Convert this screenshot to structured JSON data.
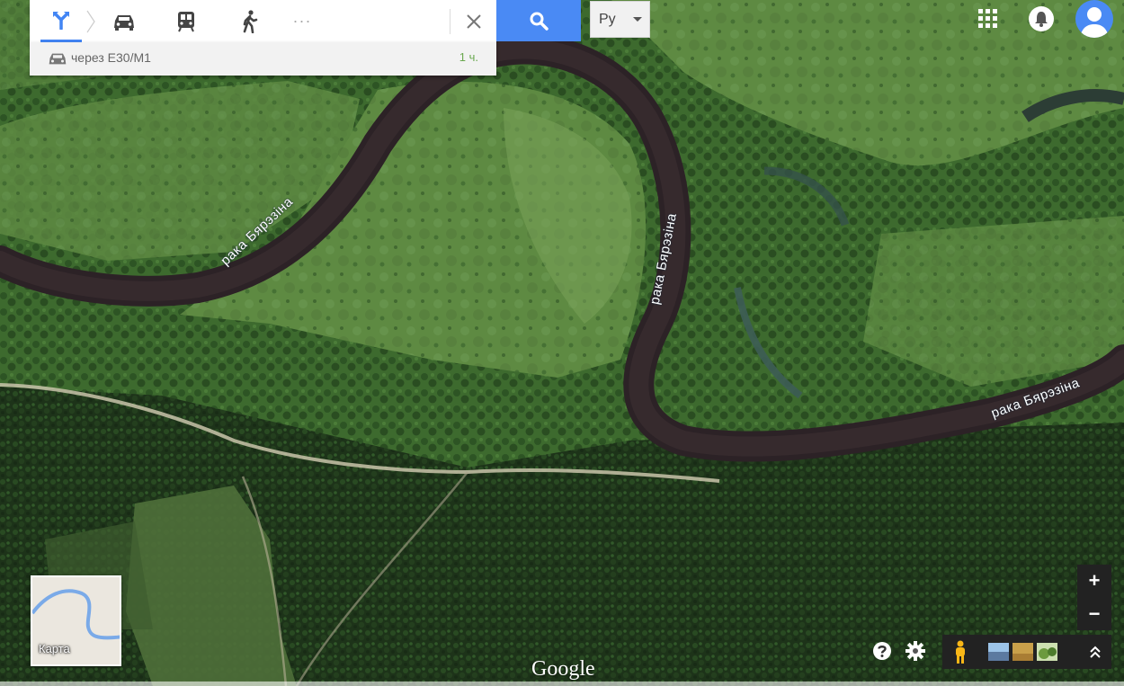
{
  "directions": {
    "modes": [
      {
        "name": "directions-mode-icon",
        "active": true
      },
      {
        "name": "car-icon"
      },
      {
        "name": "transit-icon"
      },
      {
        "name": "walk-icon"
      },
      {
        "name": "more-options-icon"
      }
    ],
    "more_label": "···",
    "route_via": "через E30/M1",
    "route_time": "1 ч."
  },
  "lang": {
    "label": "Ру"
  },
  "map": {
    "river_labels": [
      "рака Бярэзіна",
      "рака Бярэзіна",
      "рака Бярэзіна"
    ]
  },
  "minimap": {
    "label": "Карта"
  },
  "zoom": {
    "in": "+",
    "out": "−"
  },
  "logo": {
    "text": "Google"
  },
  "colors": {
    "accent": "#4285f4",
    "route_time": "#6aa84f",
    "river": "#2c2226"
  }
}
